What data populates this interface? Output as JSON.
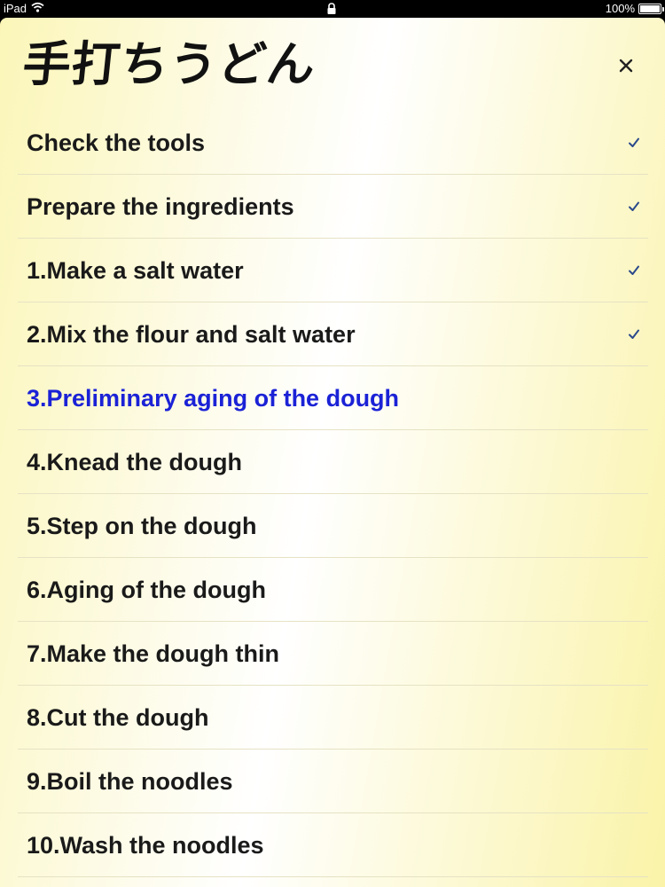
{
  "status_bar": {
    "device": "iPad",
    "battery": "100%",
    "battery_level": 1.0
  },
  "panel": {
    "title": "手打ちうどん",
    "close_icon": "close-x-icon"
  },
  "colors": {
    "current_step": "#1b22d6",
    "check": "#2c4a8c",
    "text": "#1a1a1a"
  },
  "steps": [
    {
      "label": "Check the tools",
      "checked": true,
      "current": false
    },
    {
      "label": "Prepare the ingredients",
      "checked": true,
      "current": false
    },
    {
      "label": "1.Make a salt water",
      "checked": true,
      "current": false
    },
    {
      "label": "2.Mix the flour and salt water",
      "checked": true,
      "current": false
    },
    {
      "label": "3.Preliminary aging of the dough",
      "checked": false,
      "current": true
    },
    {
      "label": "4.Knead the dough",
      "checked": false,
      "current": false
    },
    {
      "label": "5.Step on the dough",
      "checked": false,
      "current": false
    },
    {
      "label": "6.Aging of the dough",
      "checked": false,
      "current": false
    },
    {
      "label": "7.Make the dough thin",
      "checked": false,
      "current": false
    },
    {
      "label": "8.Cut the dough",
      "checked": false,
      "current": false
    },
    {
      "label": "9.Boil the noodles",
      "checked": false,
      "current": false
    },
    {
      "label": "10.Wash the noodles",
      "checked": false,
      "current": false
    }
  ]
}
